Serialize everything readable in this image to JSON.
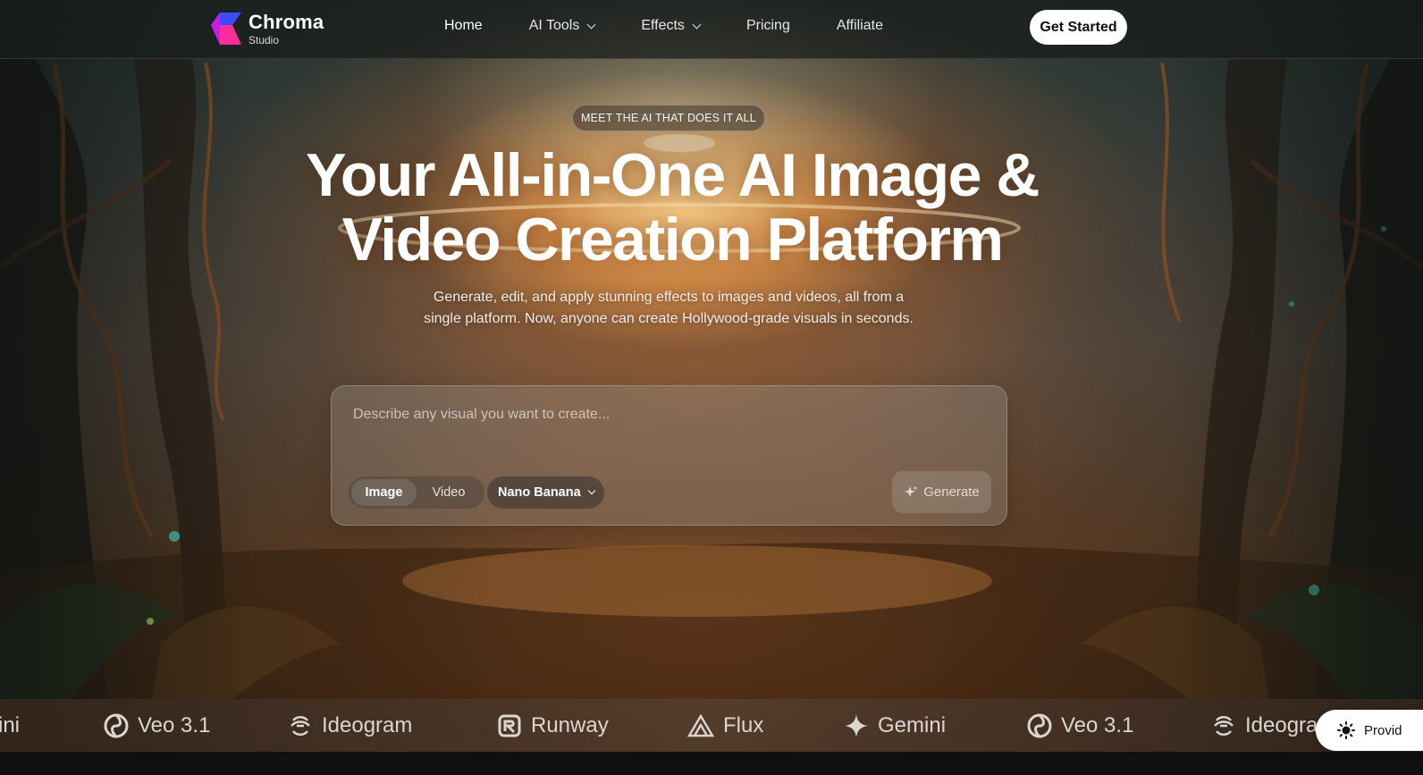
{
  "brand": {
    "name": "Chroma",
    "sub": "Studio"
  },
  "nav": {
    "items": [
      {
        "label": "Home"
      },
      {
        "label": "AI Tools"
      },
      {
        "label": "Effects"
      },
      {
        "label": "Pricing"
      },
      {
        "label": "Affiliate"
      }
    ],
    "cta": "Get Started"
  },
  "hero": {
    "badge": "MEET THE AI THAT DOES IT ALL",
    "title_line1": "Your All-in-One AI Image &",
    "title_line2": "Video Creation Platform",
    "subtitle": "Generate, edit, and apply stunning effects to images and videos, all from a single platform. Now, anyone can create Hollywood-grade visuals in seconds."
  },
  "prompt": {
    "placeholder": "Describe any visual you want to create...",
    "value": "",
    "modes": [
      "Image",
      "Video"
    ],
    "active_mode": "Image",
    "model": "Nano Banana",
    "generate_label": "Generate"
  },
  "strip": {
    "brands": [
      "ini",
      "Veo 3.1",
      "Ideogram",
      "Runway",
      "Flux",
      "Gemini",
      "Veo 3.1",
      "Ideogra"
    ]
  },
  "provider_pill": {
    "label": "Provid"
  },
  "colors": {
    "logo_blue": "#3b4bff",
    "logo_pink": "#ff2d9a",
    "cta_bg": "#ffffff"
  }
}
